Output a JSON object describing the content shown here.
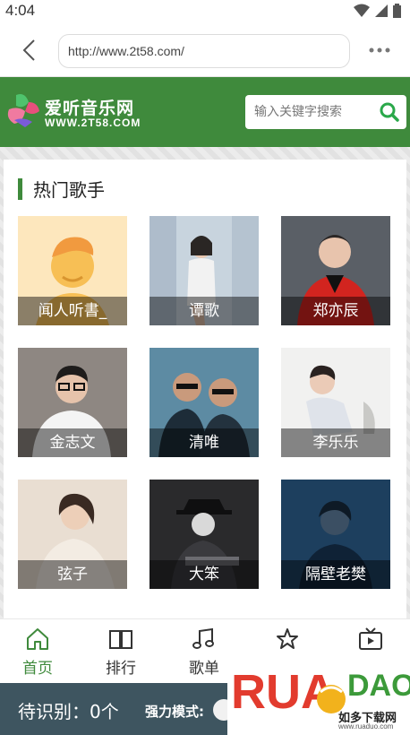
{
  "status_bar": {
    "time": "4:04"
  },
  "browser": {
    "url": "http://www.2t58.com/"
  },
  "site": {
    "logo_title": "爱听音乐网",
    "logo_sub": "WWW.2T58.COM",
    "search_placeholder": "输入关键字搜索"
  },
  "section": {
    "title": "热门歌手"
  },
  "artists": [
    {
      "name": "闻人听書_"
    },
    {
      "name": "谭歌"
    },
    {
      "name": "郑亦辰"
    },
    {
      "name": "金志文"
    },
    {
      "name": "清唯"
    },
    {
      "name": "李乐乐"
    },
    {
      "name": "弦子"
    },
    {
      "name": "大笨"
    },
    {
      "name": "隔壁老樊"
    }
  ],
  "nav": [
    {
      "label": "首页",
      "icon": "home-icon"
    },
    {
      "label": "排行",
      "icon": "book-icon"
    },
    {
      "label": "歌单",
      "icon": "music-note-icon"
    },
    {
      "label": "",
      "icon": "star-icon"
    },
    {
      "label": "",
      "icon": "video-icon"
    }
  ],
  "recognition": {
    "pending": "待识别：0个",
    "mode_label": "强力模式:"
  },
  "watermark": {
    "brand": "RUAN",
    "brand_tail": "DAO",
    "site_cn": "如多下载网",
    "site_url": "www.ruaduo.com"
  },
  "colors": {
    "accent": "#3f8a3c",
    "strip": "#3e5560",
    "watermark_red": "#e23b2e"
  }
}
